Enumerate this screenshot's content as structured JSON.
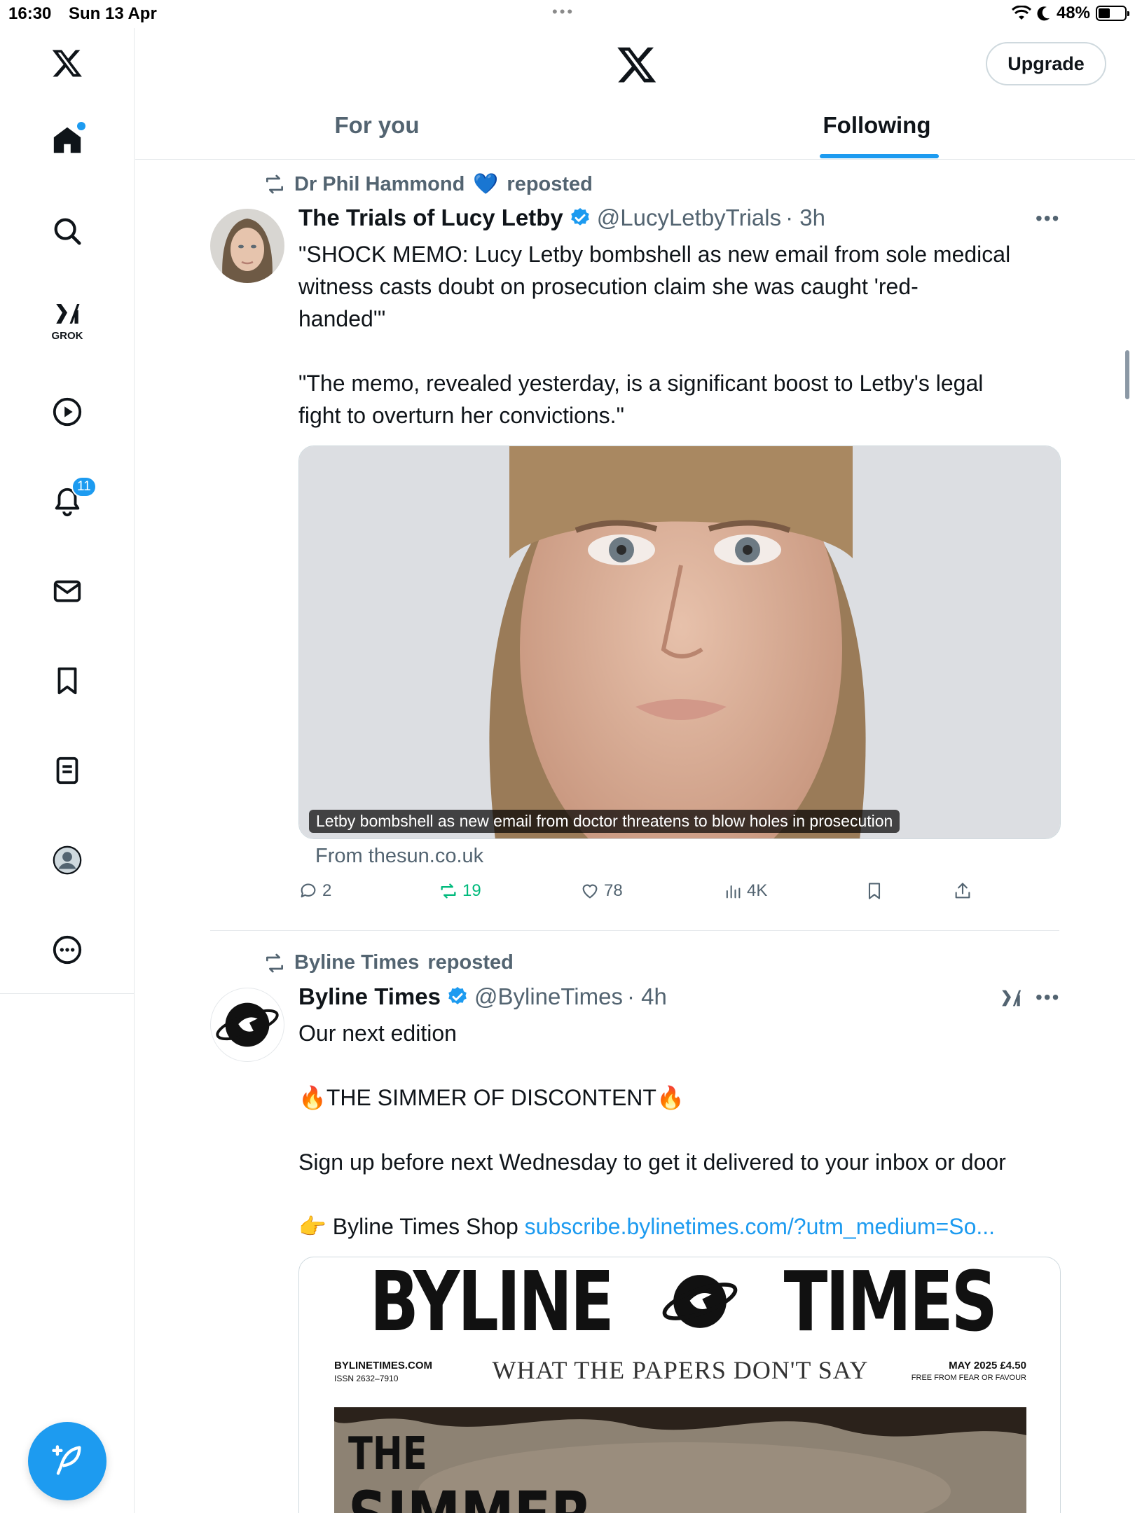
{
  "status_bar": {
    "time": "16:30",
    "date": "Sun 13 Apr",
    "battery": "48%",
    "battery_level": 0.48
  },
  "sidebar": {
    "items": [
      {
        "name": "x-logo"
      },
      {
        "name": "home-icon",
        "badge_dot": true
      },
      {
        "name": "search-icon"
      },
      {
        "name": "grok-icon",
        "label": "GROK"
      },
      {
        "name": "video-icon"
      },
      {
        "name": "notifications-icon",
        "badge": "11"
      },
      {
        "name": "messages-icon"
      },
      {
        "name": "bookmarks-icon"
      },
      {
        "name": "lists-icon"
      },
      {
        "name": "profile-icon"
      },
      {
        "name": "more-icon"
      }
    ]
  },
  "header": {
    "upgrade_label": "Upgrade",
    "tabs": [
      {
        "label": "For you",
        "active": false
      },
      {
        "label": "Following",
        "active": true
      }
    ]
  },
  "colors": {
    "accent": "#1d9bf0",
    "text": "#0f1419",
    "secondary": "#536471",
    "retweet_green": "#00ba7c",
    "border": "#e5e8eb"
  },
  "tweets": [
    {
      "repost_by": "Dr Phil Hammond",
      "repost_heart": "💙",
      "repost_suffix": "reposted",
      "name": "The Trials of Lucy Letby",
      "handle": "@LucyLetbyTrials",
      "time": "· 3h",
      "text_lines": [
        "\"SHOCK MEMO: Lucy Letby bombshell as new email from sole medical",
        "witness casts doubt on prosecution claim she was caught 'red-",
        "handed'\"",
        "",
        "\"The memo, revealed yesterday, is a significant boost to Letby's legal",
        "fight to overturn her convictions.\""
      ],
      "media_caption": "Letby bombshell as new email from doctor threatens to blow holes in prosecution",
      "source": "From thesun.co.uk",
      "actions": {
        "replies": "2",
        "reposts": "19",
        "likes": "78",
        "views": "4K"
      }
    },
    {
      "repost_by": "Byline Times",
      "repost_suffix": "reposted",
      "name": "Byline Times",
      "handle": "@BylineTimes",
      "time": "· 4h",
      "line1": "Our next edition",
      "headline": "THE SIMMER OF DISCONTENT",
      "fire": "🔥",
      "line3": "Sign up before next Wednesday to get it delivered to your inbox or door",
      "pointer": "👉",
      "shop_text": "Byline Times Shop",
      "link": "subscribe.bylinetimes.com/?utm_medium=So...",
      "paper": {
        "masthead_left": "BYLINE",
        "masthead_right": "TIMES",
        "site": "BYLINETIMES.COM",
        "issn": "ISSN 2632–7910",
        "tagline": "WHAT THE PAPERS DON'T SAY",
        "issue": "MAY 2025 £4.50",
        "motto": "FREE FROM FEAR OR FAVOUR",
        "cover_word_1": "THE",
        "cover_word_2": "SIMMER"
      }
    }
  ]
}
